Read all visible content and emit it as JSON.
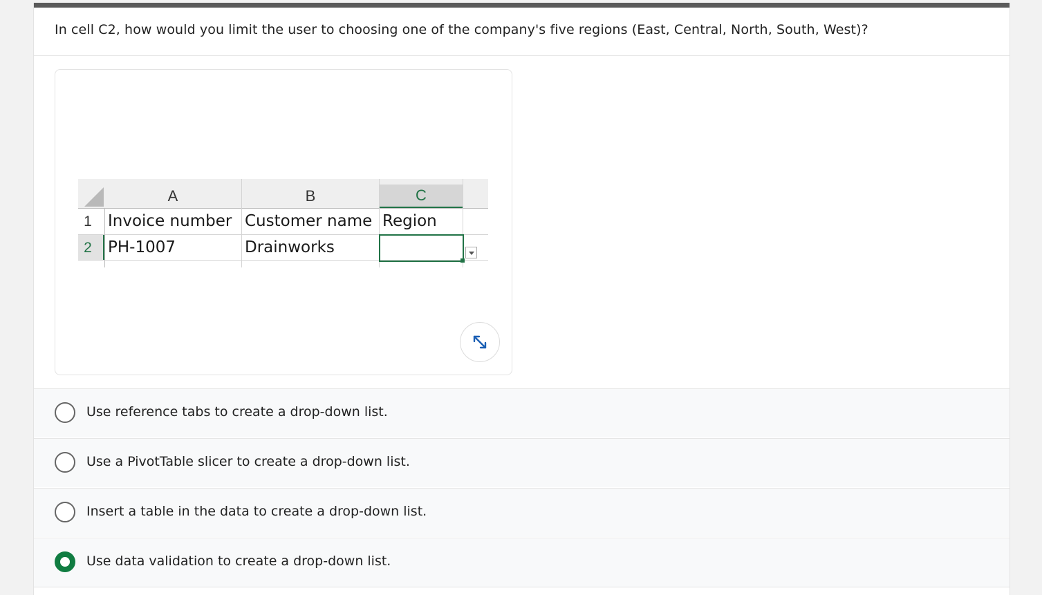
{
  "question": "In cell C2, how would you limit the user to choosing one of the company's five regions (East, Central, North, South, West)?",
  "spreadsheet": {
    "columns": [
      "A",
      "B",
      "C"
    ],
    "rows": [
      {
        "num": "1",
        "cells": [
          "Invoice number",
          "Customer name",
          "Region"
        ]
      },
      {
        "num": "2",
        "cells": [
          "PH-1007",
          "Drainworks",
          ""
        ]
      }
    ]
  },
  "expand_icon": "expand-arrows-icon",
  "options": [
    {
      "label": "Use reference tabs to create a drop-down list.",
      "selected": false
    },
    {
      "label": "Use a PivotTable slicer to create a drop-down list.",
      "selected": false
    },
    {
      "label": "Insert a table in the data to create a drop-down list.",
      "selected": false
    },
    {
      "label": "Use data validation to create a drop-down list.",
      "selected": true
    }
  ],
  "colors": {
    "accent": "#107c41",
    "topbar": "#5a5a5a"
  }
}
